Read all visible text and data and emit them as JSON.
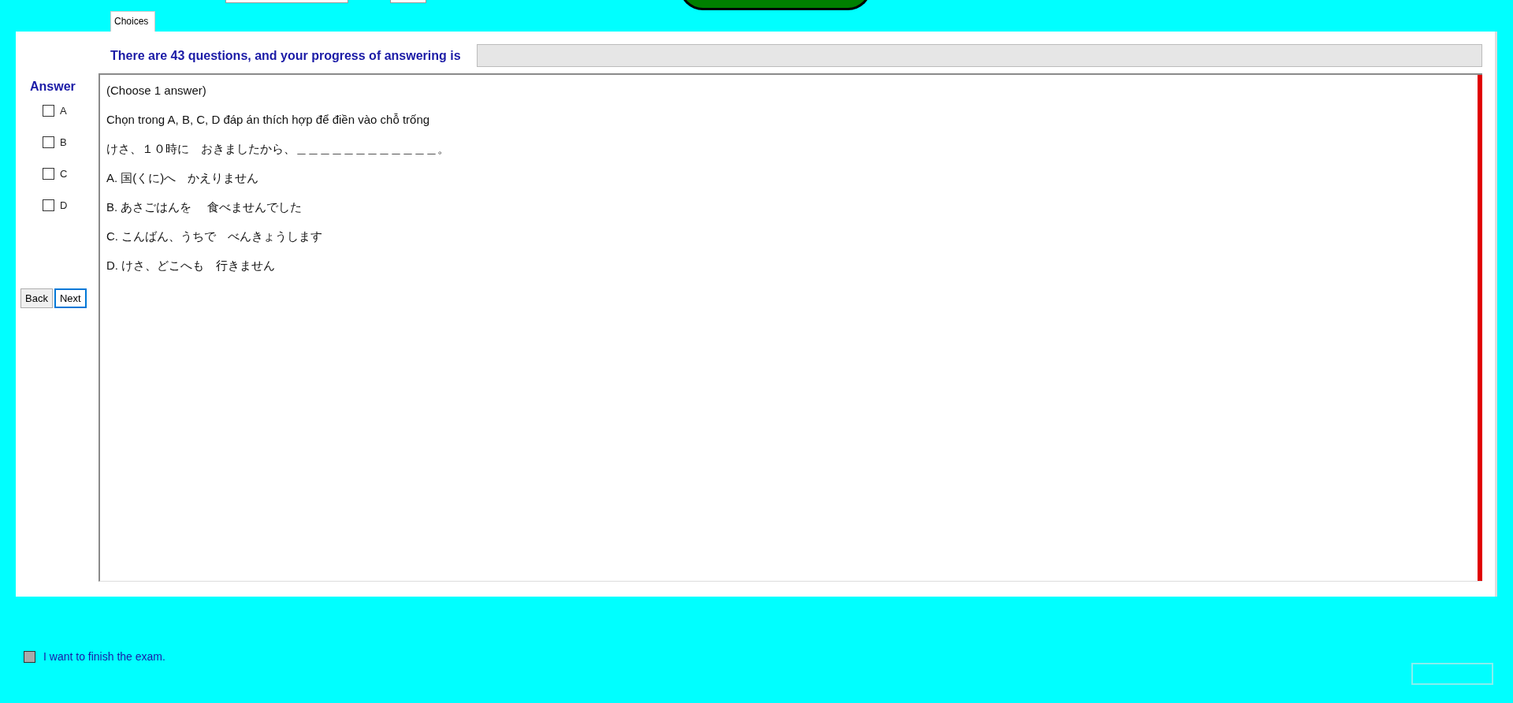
{
  "tabs": [
    {
      "label": "Choices",
      "selected": true
    }
  ],
  "progress": {
    "text": "There are 43 questions, and your progress of answering is",
    "level": 0
  },
  "answer": {
    "title": "Answer",
    "options": [
      {
        "label": "A",
        "checked": false
      },
      {
        "label": "B",
        "checked": false
      },
      {
        "label": "C",
        "checked": false
      },
      {
        "label": "D",
        "checked": false
      }
    ]
  },
  "nav_buttons": [
    {
      "label": "Back",
      "focused": false
    },
    {
      "label": "Next",
      "focused": true
    }
  ],
  "question": {
    "lines": [
      "(Choose 1 answer)",
      "Chọn trong A, B, C, D đáp án thích hợp để điền vào chỗ trống",
      "けさ、１０時に　おきましたから、＿＿＿＿＿＿＿＿＿＿＿＿。",
      "A.  国(くに)へ　かえりません",
      "B.  あさごはんを　 食べませんでした",
      "C.  こんばん、うちで　べんきょうします",
      "D.  けさ、どこへも　行きません"
    ]
  },
  "finish": {
    "label": "I want to finish the exam.",
    "checked": false
  }
}
